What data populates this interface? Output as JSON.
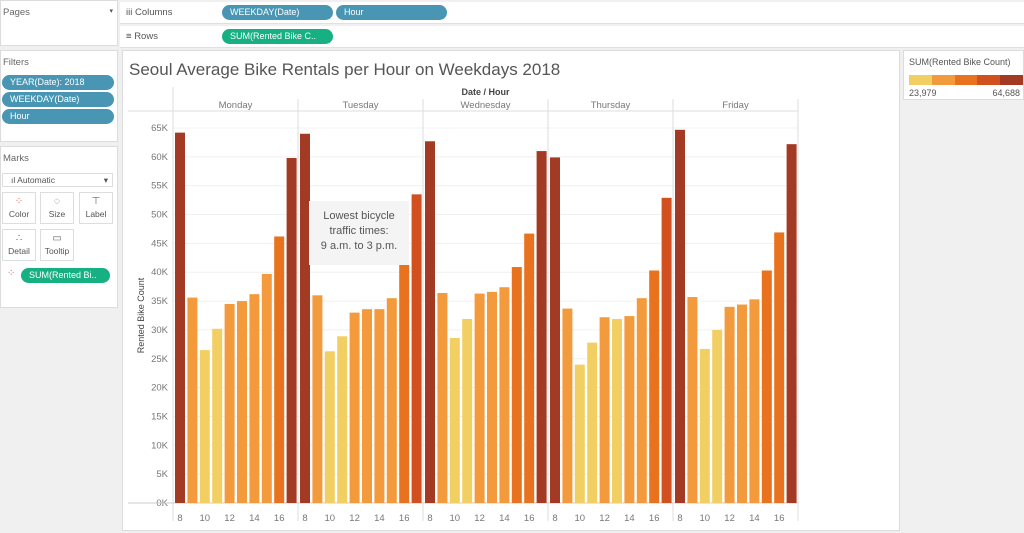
{
  "pages": {
    "title": "Pages"
  },
  "shelves": {
    "columns_label": "Columns",
    "rows_label": "Rows",
    "columns": [
      "WEEKDAY(Date)",
      "Hour"
    ],
    "rows": [
      "SUM(Rented Bike C.."
    ]
  },
  "filters": {
    "title": "Filters",
    "items": [
      "YEAR(Date): 2018",
      "WEEKDAY(Date)",
      "Hour"
    ]
  },
  "marks": {
    "title": "Marks",
    "type": "Automatic",
    "buttons": [
      "Color",
      "Size",
      "Label",
      "Detail",
      "Tooltip"
    ],
    "pill": "SUM(Rented Bi.."
  },
  "legend": {
    "title": "SUM(Rented Bike Count)",
    "min": "23,979",
    "max": "64,688",
    "colors": [
      "#f2cf63",
      "#f39a3d",
      "#e9721f",
      "#d2501f",
      "#a33a24"
    ]
  },
  "chart_data": {
    "type": "bar",
    "title": "Seoul Average Bike Rentals per Hour on Weekdays 2018",
    "xlabel": "Date / Hour",
    "ylabel": "Rented Bike Count",
    "ylim": [
      0,
      65000
    ],
    "yticks": [
      "0K",
      "5K",
      "10K",
      "15K",
      "20K",
      "25K",
      "30K",
      "35K",
      "40K",
      "45K",
      "50K",
      "55K",
      "60K",
      "65K"
    ],
    "hours": [
      8,
      9,
      10,
      11,
      12,
      13,
      14,
      15,
      16,
      17
    ],
    "xtick_labels": [
      "8",
      "10",
      "12",
      "14",
      "16"
    ],
    "grid": true,
    "annotation": [
      "Lowest bicycle",
      "traffic times:",
      "9 a.m. to 3 p.m."
    ],
    "series": [
      {
        "name": "Monday",
        "values": [
          64200,
          35600,
          26500,
          30200,
          34500,
          35000,
          36200,
          39700,
          46200,
          59800
        ]
      },
      {
        "name": "Tuesday",
        "values": [
          64000,
          36000,
          26300,
          28900,
          33000,
          33600,
          33600,
          35500,
          41300,
          53500
        ]
      },
      {
        "name": "Wednesday",
        "values": [
          62700,
          36400,
          28600,
          31900,
          36300,
          36600,
          37400,
          40900,
          46700,
          61000
        ]
      },
      {
        "name": "Thursday",
        "values": [
          59900,
          33700,
          23979,
          27800,
          32200,
          31900,
          32400,
          35500,
          40300,
          52900
        ]
      },
      {
        "name": "Friday",
        "values": [
          64688,
          35700,
          26700,
          30000,
          34000,
          34400,
          35300,
          40300,
          46900,
          62200
        ]
      }
    ]
  }
}
